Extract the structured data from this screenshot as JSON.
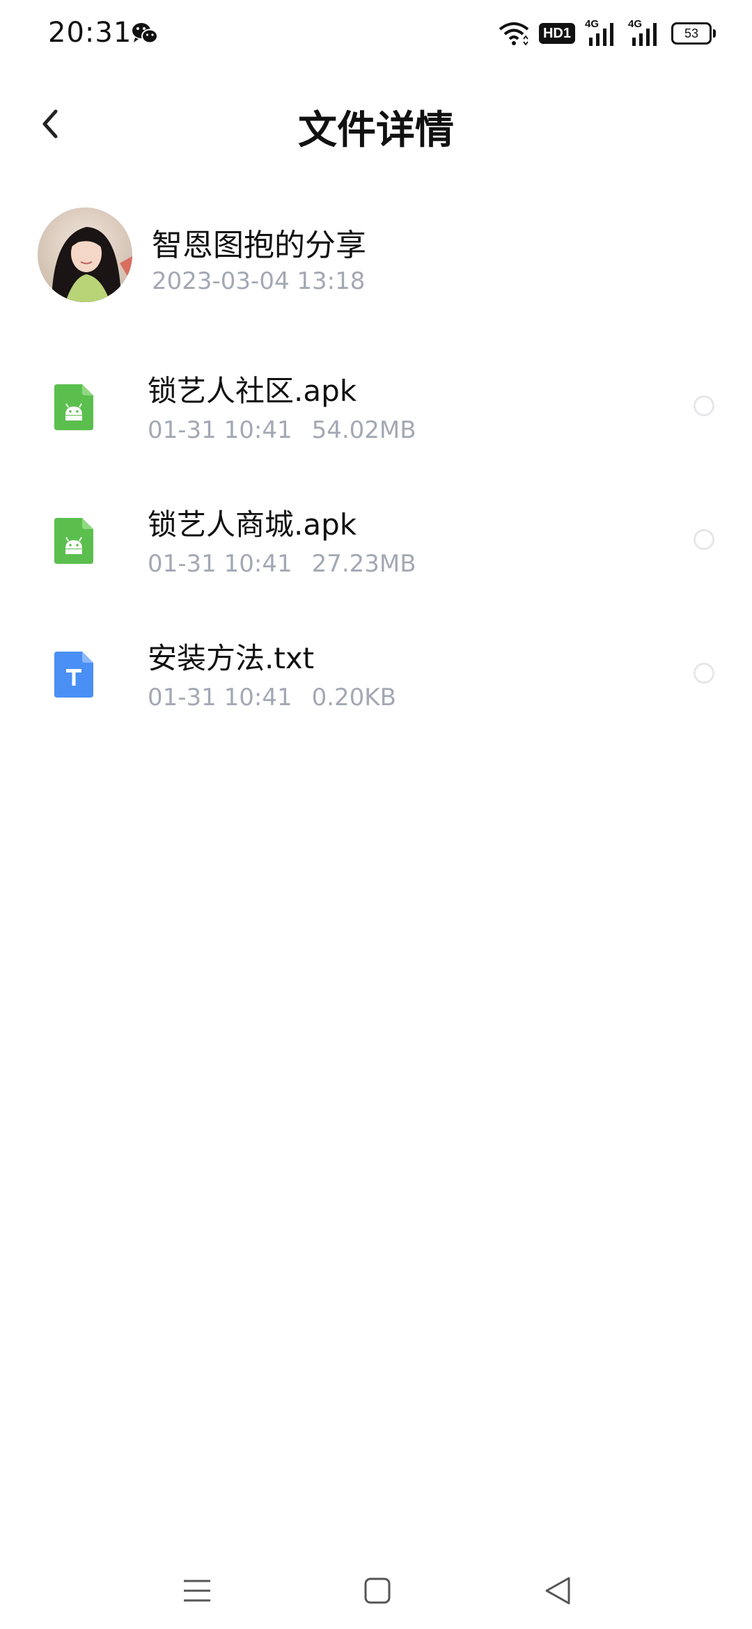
{
  "status_bar": {
    "time": "20:31",
    "hd_label": "HD1",
    "signal1_tag": "4G",
    "signal2_tag": "4G",
    "battery": "53",
    "icons": [
      "wechat-icon",
      "wifi-icon",
      "hd-icon",
      "signal-icon",
      "signal-icon",
      "battery-icon"
    ]
  },
  "header": {
    "title": "文件详情",
    "back_icon": "chevron-left-icon"
  },
  "sender": {
    "name": "智恩图抱的分享",
    "time": "2023-03-04  13:18"
  },
  "files": [
    {
      "name": "锁艺人社区.apk",
      "date": "01-31  10:41",
      "size": "54.02MB",
      "icon": "android-apk-icon",
      "color": "#5bbf4e"
    },
    {
      "name": "锁艺人商城.apk",
      "date": "01-31  10:41",
      "size": "27.23MB",
      "icon": "android-apk-icon",
      "color": "#5bbf4e"
    },
    {
      "name": "安装方法.txt",
      "date": "01-31  10:41",
      "size": "0.20KB",
      "icon": "text-file-icon",
      "color": "#4a8ff5"
    }
  ],
  "nav_bar": {
    "icons": [
      "menu-icon",
      "home-icon",
      "back-triangle-icon"
    ]
  }
}
